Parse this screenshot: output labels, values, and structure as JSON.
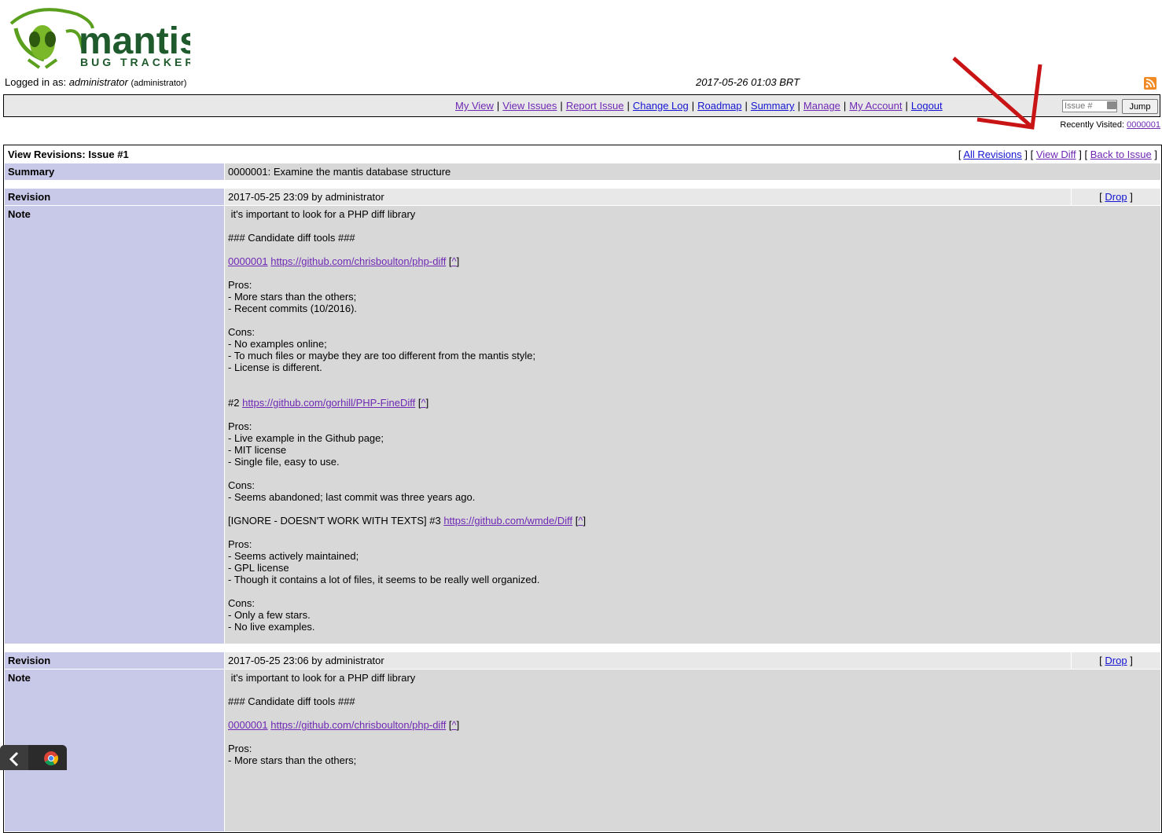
{
  "header": {
    "logged_in_prefix": "Logged in as:",
    "username": "administrator",
    "role": "(administrator)",
    "datetime": "2017-05-26 01:03 BRT"
  },
  "menu": {
    "items": [
      "My View",
      "View Issues",
      "Report Issue",
      "Change Log",
      "Roadmap",
      "Summary",
      "Manage",
      "My Account",
      "Logout"
    ],
    "separator": "|",
    "jump_placeholder": "Issue #",
    "jump_button": "Jump"
  },
  "recently_visited": {
    "label": "Recently Visited:",
    "issue": "0000001"
  },
  "page": {
    "title": "View Revisions: Issue #1",
    "links": [
      "All Revisions",
      "View Diff",
      "Back to Issue"
    ],
    "summary_label": "Summary",
    "summary_value": "0000001: Examine the mantis database structure",
    "revision_label": "Revision",
    "note_label": "Note",
    "drop_label": "Drop"
  },
  "revisions": [
    {
      "meta": "2017-05-25 23:09 by administrator",
      "note": {
        "intro": "it's important to look for a PHP diff library",
        "heading": "### Candidate diff tools ###",
        "c1_prefix": "0000001",
        "c1_link": "https://github.com/chrisboulton/php-diff",
        "c1_pros": [
          "Pros:",
          "- More stars than the others;",
          "- Recent commits (10/2016)."
        ],
        "c1_cons": [
          "Cons:",
          "- No examples online;",
          "- To much files or maybe they are too different from the mantis style;",
          "- License is different."
        ],
        "c2_prefix": "#2",
        "c2_link": "https://github.com/gorhill/PHP-FineDiff",
        "c2_pros": [
          "Pros:",
          "- Live example in the Github page;",
          "- MIT license",
          "- Single file, easy to use."
        ],
        "c2_cons": [
          "Cons:",
          "- Seems abandoned; last commit was three years ago."
        ],
        "c3_prefix": "[IGNORE - DOESN'T WORK WITH TEXTS] #3",
        "c3_link": "https://github.com/wmde/Diff",
        "c3_pros": [
          "Pros:",
          "- Seems actively maintained;",
          "- GPL license",
          "- Though it contains a lot of files, it seems to be really well organized."
        ],
        "c3_cons": [
          "Cons:",
          "- Only a few stars.",
          "- No live examples."
        ],
        "caret": "^"
      }
    },
    {
      "meta": "2017-05-25 23:06 by administrator",
      "note": {
        "intro": "it's important to look for a PHP diff library",
        "heading": "### Candidate diff tools ###",
        "c1_prefix": "0000001",
        "c1_link": "https://github.com/chrisboulton/php-diff",
        "c1_pros": [
          "Pros:",
          "- More stars than the others;"
        ],
        "caret": "^"
      }
    }
  ],
  "colors": {
    "category_bg": "#c8c8e8",
    "row_light": "#e8e8e8",
    "row_dark": "#d8d8d8",
    "link": "#1414d2",
    "visited_link": "#6e28b4",
    "annotation_arrow": "#c81414"
  }
}
